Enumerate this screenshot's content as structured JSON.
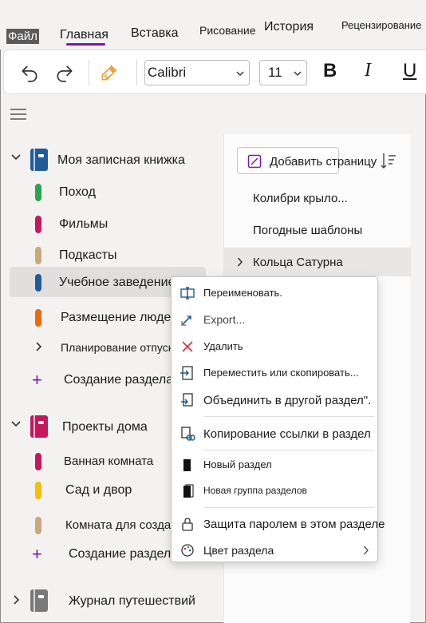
{
  "ribbon": {
    "tabs": {
      "file": "Файл",
      "home": "Главная",
      "insert": "Вставка",
      "draw": "Рисование",
      "history": "История",
      "review": "Рецензирование"
    },
    "font_name": "Calibri",
    "font_size": "11",
    "bold": "B",
    "italic": "I",
    "underline": "U"
  },
  "navigation": {
    "notebooks": [
      {
        "name": "Моя записная книжка",
        "color": "#1f5c99",
        "expanded": true,
        "sections": [
          {
            "name": "Поход",
            "color": "#2da44e"
          },
          {
            "name": "Фильмы",
            "color": "#c5175d"
          },
          {
            "name": "Подкасты",
            "color": "#c8a97e"
          },
          {
            "name": "Учебное заведение",
            "color": "#1f5c99",
            "selected": true
          },
          {
            "name": "Размещение людей",
            "color": "#ea6a0c"
          },
          {
            "name": "Планирование отпусков",
            "group": true
          },
          {
            "name": "Создание раздела",
            "add": true
          }
        ]
      },
      {
        "name": "Проекты дома",
        "color": "#c5175d",
        "expanded": true,
        "sections": [
          {
            "name": "Ванная комната",
            "color": "#c5175d"
          },
          {
            "name": "Сад и двор",
            "color": "#f5c000"
          },
          {
            "name": "Комната для создания",
            "color": "#c8a97e"
          },
          {
            "name": "Создание раздела",
            "add": true
          }
        ]
      },
      {
        "name": "Журнал путешествий",
        "color": "#7a7a7a",
        "expanded": false
      }
    ]
  },
  "pages": {
    "add_page_label": "Добавить страницу",
    "items": [
      {
        "title": "Колибри крыло..."
      },
      {
        "title": "Погодные шаблоны"
      },
      {
        "title": "Кольца Сатурна",
        "selected": true
      }
    ]
  },
  "context_menu": {
    "items": [
      {
        "label": "Переименовать."
      },
      {
        "label": "Export..."
      },
      {
        "label": "Удалить"
      },
      {
        "label": "Переместить или скопировать..."
      },
      {
        "label": "Объединить в другой раздел\"."
      },
      {
        "label": "Копирование ссылки в раздел"
      },
      {
        "label": "Новый раздел"
      },
      {
        "label": "Новая группа разделов"
      },
      {
        "label": "Защита паролем в этом разделе"
      },
      {
        "label": "Цвет раздела"
      }
    ]
  },
  "colors": {
    "accent": "#7719aa",
    "delete_icon": "#d13438"
  }
}
